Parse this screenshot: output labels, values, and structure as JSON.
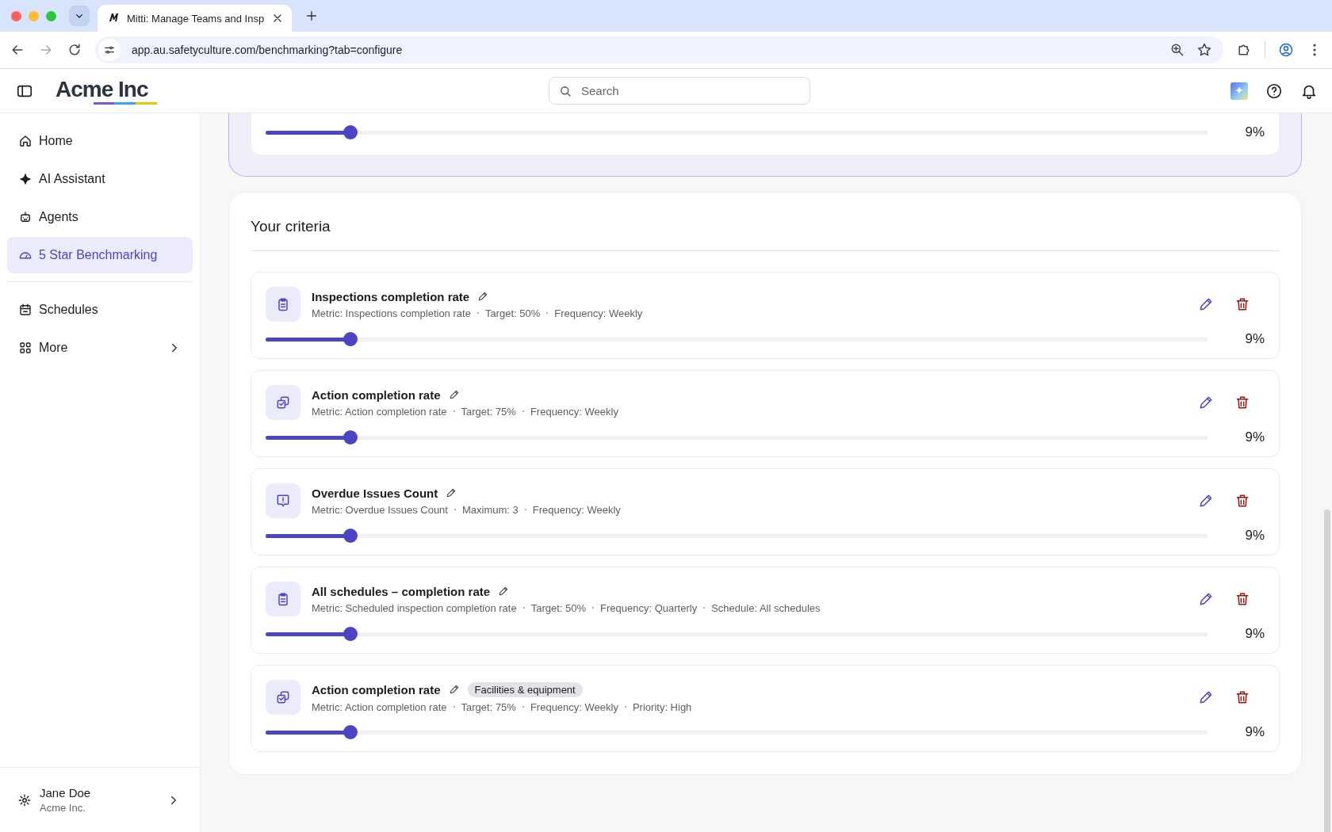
{
  "browser": {
    "tabs": [
      {
        "title": "Mitti: Manage Teams and Insp",
        "selected": true
      }
    ],
    "url": "app.au.safetyculture.com/benchmarking?tab=configure"
  },
  "header": {
    "logo": "Acme Inc",
    "search": {
      "placeholder": "Search"
    }
  },
  "sidebar": {
    "groups": [
      [
        {
          "label": "Home",
          "selected": false,
          "submenu": false
        },
        {
          "label": "AI Assistant",
          "selected": false,
          "submenu": false
        },
        {
          "label": "Agents",
          "selected": false,
          "submenu": false
        },
        {
          "label": "5 Star Benchmarking",
          "selected": true,
          "submenu": false
        }
      ],
      [
        {
          "label": "Schedules",
          "selected": false,
          "submenu": false
        },
        {
          "label": "More",
          "selected": false,
          "submenu": true
        }
      ]
    ],
    "user": {
      "name": "Jane Doe",
      "org": "Acme Inc."
    }
  },
  "top_card": {
    "level": 0.09,
    "reading": "9%"
  },
  "criteria": {
    "title": "Your criteria",
    "items": [
      {
        "kind": "inspection",
        "title": "Inspections completion rate",
        "details": [
          "Metric: Inspections completion rate",
          "Target: 50%",
          "Frequency: Weekly"
        ],
        "level": 0.09,
        "reading": "9%"
      },
      {
        "kind": "action",
        "title": "Action completion rate",
        "details": [
          "Metric: Action completion rate",
          "Target: 75%",
          "Frequency: Weekly"
        ],
        "level": 0.09,
        "reading": "9%"
      },
      {
        "kind": "issue",
        "title": "Overdue Issues Count",
        "details": [
          "Metric: Overdue Issues Count",
          "Maximum: 3",
          "Frequency: Weekly"
        ],
        "level": 0.09,
        "reading": "9%"
      },
      {
        "kind": "inspection",
        "title": "All schedules – completion rate",
        "details": [
          "Metric: Scheduled inspection completion rate",
          "Target: 50%",
          "Frequency: Quarterly",
          "Schedule: All schedules"
        ],
        "level": 0.09,
        "reading": "9%"
      },
      {
        "kind": "action",
        "title": "Action completion rate",
        "tag": "Facilities & equipment",
        "details": [
          "Metric: Action completion rate",
          "Target: 75%",
          "Frequency: Weekly",
          "Priority: High"
        ],
        "level": 0.09,
        "reading": "9%"
      }
    ]
  }
}
